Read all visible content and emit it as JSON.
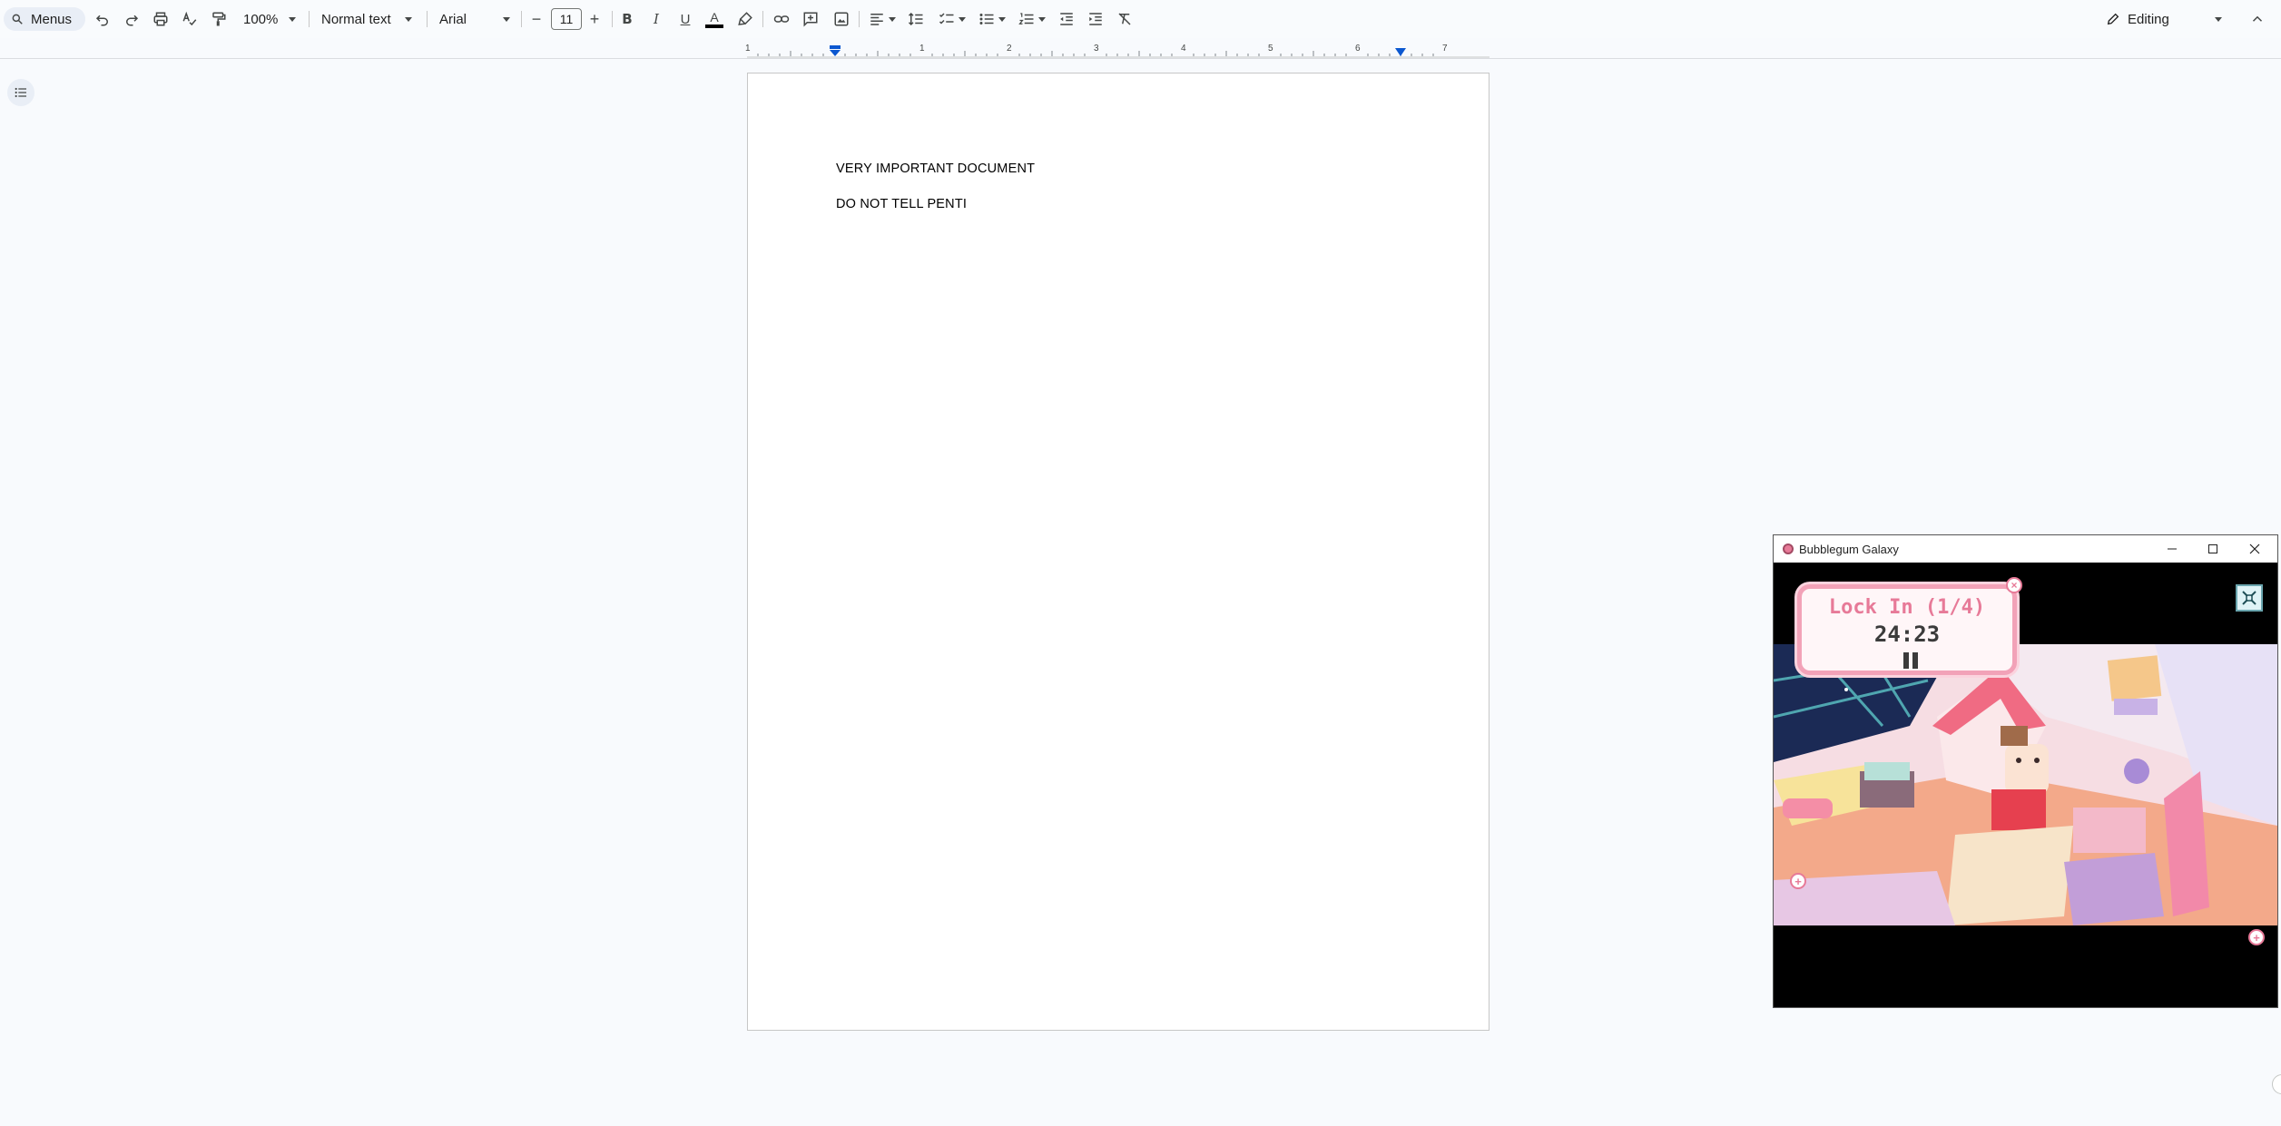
{
  "toolbar": {
    "menus_label": "Menus",
    "zoom": "100%",
    "paragraph_style": "Normal text",
    "font_family": "Arial",
    "font_size": "11",
    "mode_label": "Editing"
  },
  "ruler": {
    "labels": [
      "1",
      "1",
      "2",
      "3",
      "4",
      "5",
      "6",
      "7"
    ]
  },
  "document": {
    "lines": [
      "VERY IMPORTANT DOCUMENT",
      "DO NOT TELL PENTI"
    ]
  },
  "game_window": {
    "title": "Bubblegum Galaxy",
    "timer_title": "Lock In (1/4)",
    "timer_value": "24:23"
  },
  "colors": {
    "accent": "#0b57d0",
    "timer_pink": "#e77a98",
    "text_color_bar": "#000000"
  }
}
